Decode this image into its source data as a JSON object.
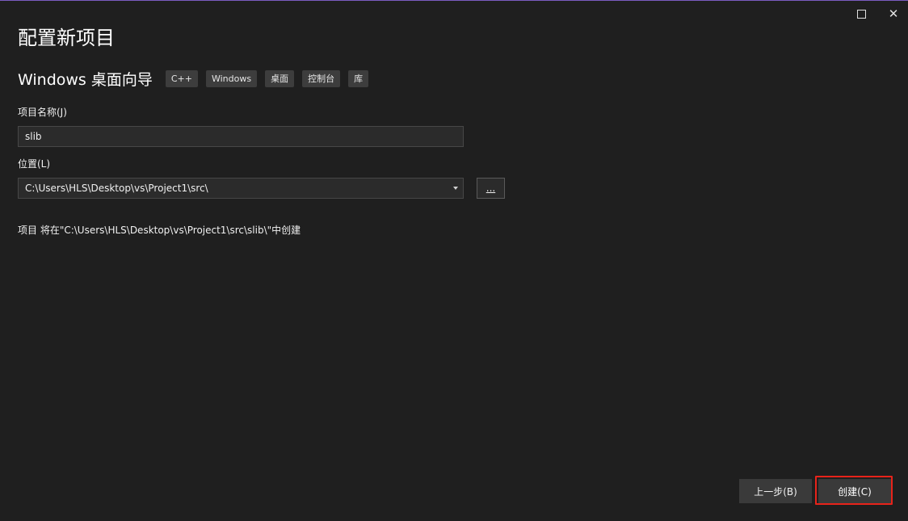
{
  "window": {
    "title": "配置新项目",
    "controls": {
      "maximize_icon": "maximize-icon",
      "close_glyph": "✕"
    }
  },
  "template": {
    "name": "Windows 桌面向导",
    "tags": [
      "C++",
      "Windows",
      "桌面",
      "控制台",
      "库"
    ]
  },
  "form": {
    "project_name_label": "项目名称(J)",
    "project_name_value": "slib",
    "location_label": "位置(L)",
    "location_value": "C:\\Users\\HLS\\Desktop\\vs\\Project1\\src\\",
    "browse_label": "...",
    "path_note": "项目 将在\"C:\\Users\\HLS\\Desktop\\vs\\Project1\\src\\slib\\\"中创建"
  },
  "footer": {
    "back_label": "上一步(B)",
    "create_label": "创建(C)"
  },
  "colors": {
    "background": "#1f1f1f",
    "input_bg": "#2b2b2b",
    "tag_bg": "#3d3d3d",
    "button_bg": "#3a3a3a",
    "highlight": "#e8231a",
    "top_border": "#7a5cc0"
  }
}
